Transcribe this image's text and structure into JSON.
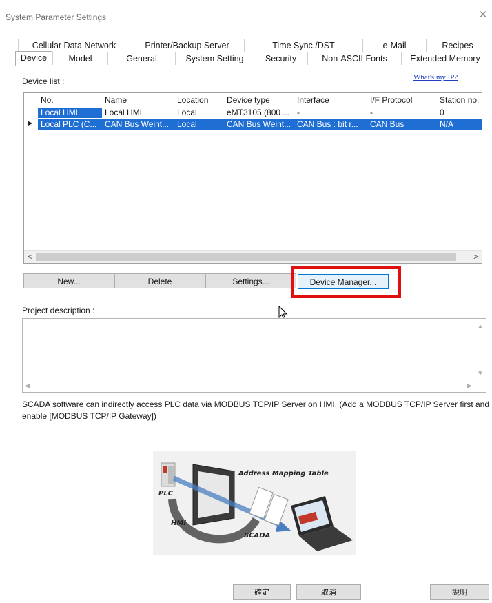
{
  "window": {
    "title": "System Parameter Settings",
    "close_glyph": "✕"
  },
  "tabs": {
    "back_row": [
      "Cellular Data Network",
      "Printer/Backup Server",
      "Time Sync./DST",
      "e-Mail",
      "Recipes"
    ],
    "front_row": [
      "Device",
      "Model",
      "General",
      "System Setting",
      "Security",
      "Non-ASCII Fonts",
      "Extended Memory"
    ],
    "active": "Device"
  },
  "device_list": {
    "label": "Device list :",
    "whats_my_ip": "What's my IP?",
    "columns": [
      "No.",
      "Name",
      "Location",
      "Device type",
      "Interface",
      "I/F Protocol",
      "Station no."
    ],
    "rows": [
      [
        "Local HMI",
        "Local HMI",
        "Local",
        "eMT3105 (800 ...",
        "-",
        "-",
        "0"
      ],
      [
        "Local PLC (C...",
        "CAN Bus Weint...",
        "Local",
        "CAN Bus Weint...",
        "CAN Bus : bit r...",
        "CAN Bus",
        "N/A"
      ]
    ],
    "current_row_marker": "▶",
    "scroll_left": "<",
    "scroll_right": ">"
  },
  "buttons": {
    "new": "New...",
    "delete": "Delete",
    "settings": "Settings...",
    "device_manager": "Device Manager..."
  },
  "project_description": {
    "label": "Project description :",
    "value": ""
  },
  "note": "SCADA software can indirectly access PLC data via MODBUS TCP/IP Server on HMI. (Add a MODBUS TCP/IP Server first and enable [MODBUS TCP/IP Gateway])",
  "diagram": {
    "labels": {
      "plc": "PLC",
      "hmi": "HMI",
      "scada": "SCADA",
      "mapping": "Address Mapping Table"
    }
  },
  "footer": {
    "ok": "確定",
    "cancel": "取消",
    "help": "說明"
  },
  "colors": {
    "selection": "#1f6ed4",
    "highlight_box": "#e01010"
  }
}
